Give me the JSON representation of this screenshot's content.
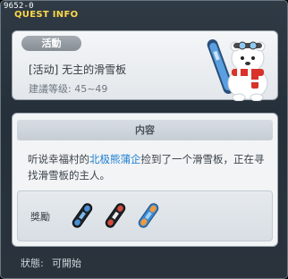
{
  "window": {
    "quest_id": "9652-0",
    "title": "QUEST INFO"
  },
  "header": {
    "badge": "活動",
    "quest_title": "[活动] 无主的滑雪板",
    "level": "建議等级: 45~49"
  },
  "content": {
    "heading": "内容",
    "desc_before": "听说幸福村的",
    "npc_name": "北极熊蒲企",
    "desc_after": "捡到了一个滑雪板，正在寻找滑雪板的主人。"
  },
  "reward": {
    "label": "獎勵",
    "items": [
      {
        "icon": "black-blue-snowboard-icon",
        "color": "#4a8fd6"
      },
      {
        "icon": "black-red-snowboard-icon",
        "color": "#d24b3c"
      },
      {
        "icon": "blue-orange-snowboard-icon",
        "color": "#f09a3a"
      }
    ]
  },
  "status": {
    "label": "狀態:",
    "value": "可開始"
  },
  "colors": {
    "title_yellow": "#ffd84a",
    "npc_link_blue": "#1f7ed0"
  }
}
